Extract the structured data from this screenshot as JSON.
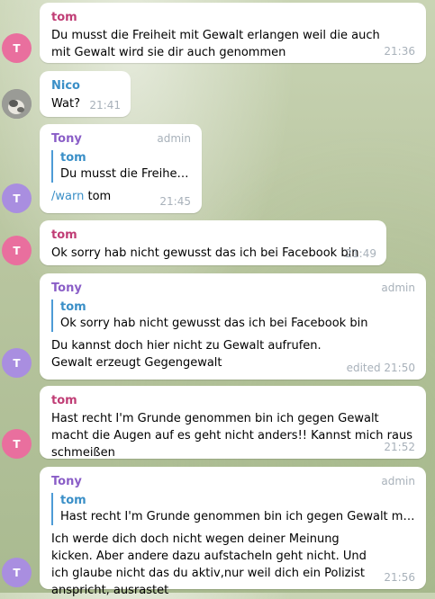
{
  "messages": [
    {
      "sender": "tom",
      "avatar": "T",
      "text": "Du musst die Freiheit mit Gewalt erlangen weil die auch mit Gewalt wird sie dir auch genommen",
      "time": "21:36"
    },
    {
      "sender": "Nico",
      "text": "Wat?",
      "time": "21:41"
    },
    {
      "sender": "Tony",
      "avatar": "T",
      "role": "admin",
      "reply_name": "tom",
      "reply_text": "Du musst die Freiheit …",
      "command": "/warn",
      "text": " tom",
      "time": "21:45"
    },
    {
      "sender": "tom",
      "avatar": "T",
      "text": "Ok sorry hab nicht gewusst das ich bei Facebook bin",
      "time": "21:49"
    },
    {
      "sender": "Tony",
      "avatar": "T",
      "role": "admin",
      "reply_name": "tom",
      "reply_text": "Ok sorry hab nicht gewusst das ich bei Facebook bin",
      "text": "Du kannst doch hier nicht zu Gewalt aufrufen. Gewalt erzeugt Gegengewalt",
      "time": "edited 21:50"
    },
    {
      "sender": "tom",
      "avatar": "T",
      "text": "Hast recht I'm Grunde genommen bin ich gegen Gewalt macht die Augen auf es geht nicht anders!! Kannst mich raus schmeißen",
      "time": "21:52"
    },
    {
      "sender": "Tony",
      "avatar": "T",
      "role": "admin",
      "reply_name": "tom",
      "reply_text": "Hast recht I'm Grunde genommen bin ich gegen Gewalt macht …",
      "text": "Ich werde dich doch nicht wegen deiner Meinung kicken.  Aber andere dazu aufstacheln geht nicht. Und ich glaube nicht das du aktiv,nur weil dich ein Polizist anspricht, ausrastet",
      "time": "21:56"
    }
  ]
}
